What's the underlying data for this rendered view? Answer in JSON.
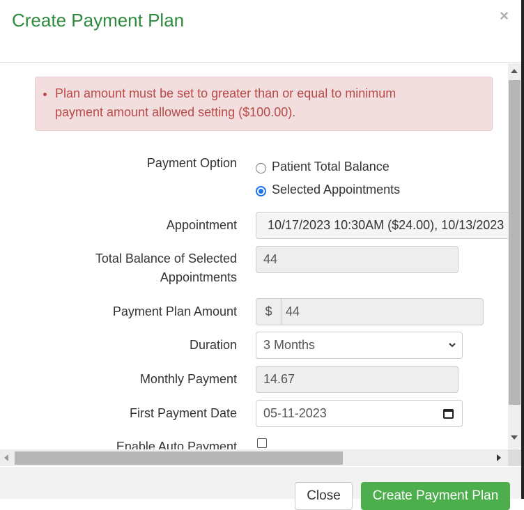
{
  "header": {
    "title": "Create Payment Plan",
    "close_icon": "×"
  },
  "alert": {
    "messages": [
      "Plan amount must be set to greater than or equal to minimum payment amount allowed setting ($100.00)."
    ]
  },
  "form": {
    "payment_option": {
      "label": "Payment Option",
      "options": [
        {
          "label": "Patient Total Balance",
          "checked": false
        },
        {
          "label": "Selected Appointments",
          "checked": true
        }
      ]
    },
    "appointment": {
      "label": "Appointment",
      "value": "10/17/2023 10:30AM ($24.00), 10/13/2023"
    },
    "total_balance": {
      "label_line1": "Total Balance of Selected",
      "label_line2": "Appointments",
      "value": "44"
    },
    "payment_plan_amount": {
      "label": "Payment Plan Amount",
      "currency": "$",
      "value": "44"
    },
    "duration": {
      "label": "Duration",
      "selected": "3 Months",
      "chevron": "⌄"
    },
    "monthly_payment": {
      "label": "Monthly Payment",
      "value": "14.67"
    },
    "first_payment_date": {
      "label": "First Payment Date",
      "value": "05-11-2023"
    },
    "enable_auto_payment": {
      "label": "Enable Auto Payment",
      "checked": false
    }
  },
  "footer": {
    "close_label": "Close",
    "create_label": "Create Payment Plan"
  }
}
